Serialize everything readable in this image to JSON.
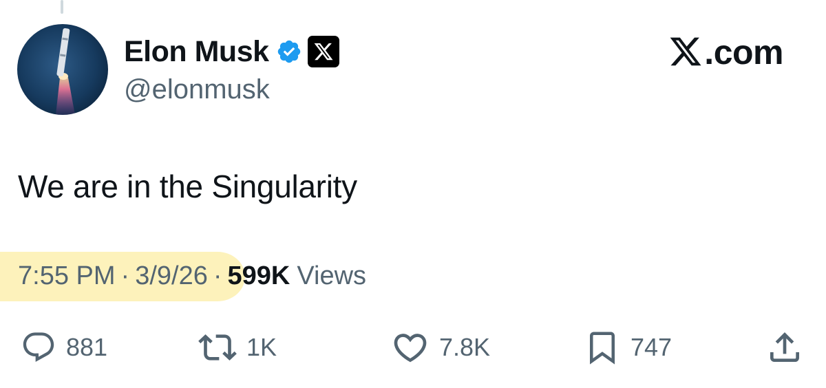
{
  "author": {
    "display_name": "Elon Musk",
    "handle": "@elonmusk",
    "verified_badge_color": "#1d9bf0",
    "affiliate_icon": "x-logo-icon"
  },
  "brand": {
    "text": ".com",
    "icon": "x-logo-icon"
  },
  "tweet": {
    "text": "We are in the Singularity",
    "time": "7:55 PM",
    "date": "3/9/26",
    "separator": "·",
    "views_count": "599K",
    "views_label": "Views",
    "highlight_color": "#fdf1b4"
  },
  "actions": {
    "reply": {
      "icon": "reply-icon",
      "count": "881"
    },
    "repost": {
      "icon": "repost-icon",
      "count": "1K"
    },
    "like": {
      "icon": "heart-icon",
      "count": "7.8K"
    },
    "bookmark": {
      "icon": "bookmark-icon",
      "count": "747"
    },
    "share": {
      "icon": "share-icon"
    }
  },
  "colors": {
    "text_primary": "#0f1419",
    "text_secondary": "#536471",
    "icon_color": "#536471"
  }
}
